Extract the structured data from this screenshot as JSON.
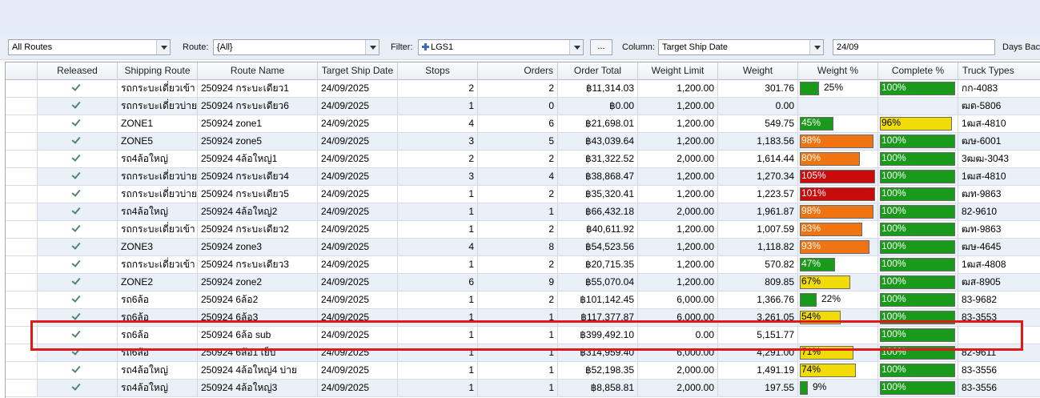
{
  "toolbar": {
    "routes_combo_value": "All Routes",
    "route_label": "Route:",
    "route_value": "{All}",
    "filter_label": "Filter:",
    "filter_value": "LGS1",
    "filter_button_label": "...",
    "column_label": "Column:",
    "column_value": "Target Ship Date",
    "date_value": "24/09",
    "days_back_label": "Days Back"
  },
  "grid": {
    "columns": [
      "Released",
      "Shipping Route",
      "Route Name",
      "Target Ship Date",
      "Stops",
      "Orders",
      "Order Total",
      "Weight Limit",
      "Weight",
      "Weight %",
      "Complete %",
      "Truck Types"
    ],
    "colors": {
      "green": "#1a9a1a",
      "yellow": "#f1dc0a",
      "orange": "#f07512",
      "red": "#c80b0b",
      "alt_row": "#eaf0f8",
      "highlight": "#e01a1a"
    },
    "rows": [
      {
        "released": true,
        "shipping_route": "รถกระบะเดี่ยวเข้า",
        "route_name": "250924 กระบะเดียว1",
        "target_ship_date": "24/09/2025",
        "stops": "2",
        "orders": "2",
        "order_total": "฿11,314.03",
        "weight_limit": "1,200.00",
        "weight": "301.76",
        "weight_pct": {
          "label": "25%",
          "value": 25,
          "color": "green"
        },
        "complete_pct": {
          "label": "100%",
          "value": 100,
          "color": "green"
        },
        "truck_types": "กก-4083"
      },
      {
        "released": true,
        "shipping_route": "รถกระบะเดี่ยวบ่าย",
        "route_name": "250924 กระบะเดียว6",
        "target_ship_date": "24/09/2025",
        "stops": "1",
        "orders": "0",
        "order_total": "฿0.00",
        "weight_limit": "1,200.00",
        "weight": "0.00",
        "weight_pct": null,
        "complete_pct": null,
        "truck_types": "ฒต-5806"
      },
      {
        "released": true,
        "shipping_route": "ZONE1",
        "route_name": "250924 zone1",
        "target_ship_date": "24/09/2025",
        "stops": "4",
        "orders": "6",
        "order_total": "฿21,698.01",
        "weight_limit": "1,200.00",
        "weight": "549.75",
        "weight_pct": {
          "label": "45%",
          "value": 45,
          "color": "green"
        },
        "complete_pct": {
          "label": "96%",
          "value": 96,
          "color": "yellow"
        },
        "truck_types": "1ฒส-4810"
      },
      {
        "released": true,
        "shipping_route": "ZONE5",
        "route_name": "250924 zone5",
        "target_ship_date": "24/09/2025",
        "stops": "3",
        "orders": "5",
        "order_total": "฿43,039.64",
        "weight_limit": "1,200.00",
        "weight": "1,183.56",
        "weight_pct": {
          "label": "98%",
          "value": 98,
          "color": "orange"
        },
        "complete_pct": {
          "label": "100%",
          "value": 100,
          "color": "green"
        },
        "truck_types": "ฒษ-6001"
      },
      {
        "released": true,
        "shipping_route": "รถ4ล้อใหญ่",
        "route_name": "250924 4ล้อใหญ่1",
        "target_ship_date": "24/09/2025",
        "stops": "2",
        "orders": "2",
        "order_total": "฿31,322.52",
        "weight_limit": "2,000.00",
        "weight": "1,614.44",
        "weight_pct": {
          "label": "80%",
          "value": 80,
          "color": "orange"
        },
        "complete_pct": {
          "label": "100%",
          "value": 100,
          "color": "green"
        },
        "truck_types": "3ฒฒ-3043"
      },
      {
        "released": true,
        "shipping_route": "รถกระบะเดี่ยวบ่าย",
        "route_name": "250924 กระบะเดียว4",
        "target_ship_date": "24/09/2025",
        "stops": "3",
        "orders": "4",
        "order_total": "฿38,868.47",
        "weight_limit": "1,200.00",
        "weight": "1,270.34",
        "weight_pct": {
          "label": "105%",
          "value": 105,
          "color": "red"
        },
        "complete_pct": {
          "label": "100%",
          "value": 100,
          "color": "green"
        },
        "truck_types": "1ฒส-4810"
      },
      {
        "released": true,
        "shipping_route": "รถกระบะเดี่ยวบ่าย",
        "route_name": "250924 กระบะเดียว5",
        "target_ship_date": "24/09/2025",
        "stops": "1",
        "orders": "2",
        "order_total": "฿35,320.41",
        "weight_limit": "1,200.00",
        "weight": "1,223.57",
        "weight_pct": {
          "label": "101%",
          "value": 101,
          "color": "red"
        },
        "complete_pct": {
          "label": "100%",
          "value": 100,
          "color": "green"
        },
        "truck_types": "ฒท-9863"
      },
      {
        "released": true,
        "shipping_route": "รถ4ล้อใหญ่",
        "route_name": "250924 4ล้อใหญ่2",
        "target_ship_date": "24/09/2025",
        "stops": "1",
        "orders": "1",
        "order_total": "฿66,432.18",
        "weight_limit": "2,000.00",
        "weight": "1,961.87",
        "weight_pct": {
          "label": "98%",
          "value": 98,
          "color": "orange"
        },
        "complete_pct": {
          "label": "100%",
          "value": 100,
          "color": "green"
        },
        "truck_types": "82-9610"
      },
      {
        "released": true,
        "shipping_route": "รถกระบะเดี่ยวเข้า",
        "route_name": "250924 กระบะเดียว2",
        "target_ship_date": "24/09/2025",
        "stops": "1",
        "orders": "2",
        "order_total": "฿40,611.92",
        "weight_limit": "1,200.00",
        "weight": "1,007.59",
        "weight_pct": {
          "label": "83%",
          "value": 83,
          "color": "orange"
        },
        "complete_pct": {
          "label": "100%",
          "value": 100,
          "color": "green"
        },
        "truck_types": "ฒท-9863"
      },
      {
        "released": true,
        "shipping_route": "ZONE3",
        "route_name": "250924 zone3",
        "target_ship_date": "24/09/2025",
        "stops": "4",
        "orders": "8",
        "order_total": "฿54,523.56",
        "weight_limit": "1,200.00",
        "weight": "1,118.82",
        "weight_pct": {
          "label": "93%",
          "value": 93,
          "color": "orange"
        },
        "complete_pct": {
          "label": "100%",
          "value": 100,
          "color": "green"
        },
        "truck_types": "ฒษ-4645"
      },
      {
        "released": true,
        "shipping_route": "รถกระบะเดี่ยวเข้า",
        "route_name": "250924 กระบะเดียว3",
        "target_ship_date": "24/09/2025",
        "stops": "1",
        "orders": "2",
        "order_total": "฿20,715.35",
        "weight_limit": "1,200.00",
        "weight": "570.82",
        "weight_pct": {
          "label": "47%",
          "value": 47,
          "color": "green"
        },
        "complete_pct": {
          "label": "100%",
          "value": 100,
          "color": "green"
        },
        "truck_types": "1ฒส-4808"
      },
      {
        "released": true,
        "shipping_route": "ZONE2",
        "route_name": "250924 zone2",
        "target_ship_date": "24/09/2025",
        "stops": "6",
        "orders": "9",
        "order_total": "฿55,070.04",
        "weight_limit": "1,200.00",
        "weight": "809.85",
        "weight_pct": {
          "label": "67%",
          "value": 67,
          "color": "yellow"
        },
        "complete_pct": {
          "label": "100%",
          "value": 100,
          "color": "green"
        },
        "truck_types": "ฒส-8905"
      },
      {
        "released": true,
        "shipping_route": "รถ6ล้อ",
        "route_name": "250924 6ล้อ2",
        "target_ship_date": "24/09/2025",
        "stops": "1",
        "orders": "2",
        "order_total": "฿101,142.45",
        "weight_limit": "6,000.00",
        "weight": "1,366.76",
        "weight_pct": {
          "label": "22%",
          "value": 22,
          "color": "green"
        },
        "complete_pct": {
          "label": "100%",
          "value": 100,
          "color": "green"
        },
        "truck_types": "83-9682"
      },
      {
        "released": true,
        "shipping_route": "รถ6ล้อ",
        "route_name": "250924 6ล้อ3",
        "target_ship_date": "24/09/2025",
        "stops": "1",
        "orders": "1",
        "order_total": "฿117,377.87",
        "weight_limit": "6,000.00",
        "weight": "3,261.05",
        "weight_pct": {
          "label": "54%",
          "value": 54,
          "color": "yellow"
        },
        "complete_pct": {
          "label": "100%",
          "value": 100,
          "color": "green"
        },
        "truck_types": "83-3553"
      },
      {
        "released": true,
        "shipping_route": "รถ6ล้อ",
        "route_name": "250924 6ล้อ sub",
        "target_ship_date": "24/09/2025",
        "stops": "1",
        "orders": "1",
        "order_total": "฿399,492.10",
        "weight_limit": "0.00",
        "weight": "5,151.77",
        "weight_pct": null,
        "complete_pct": {
          "label": "100%",
          "value": 100,
          "color": "green"
        },
        "truck_types": ""
      },
      {
        "released": true,
        "shipping_route": "รถ6ล้อ",
        "route_name": "250924 6ล้อ1 เย็บ",
        "target_ship_date": "24/09/2025",
        "stops": "1",
        "orders": "1",
        "order_total": "฿314,959.40",
        "weight_limit": "6,000.00",
        "weight": "4,291.00",
        "weight_pct": {
          "label": "71%",
          "value": 71,
          "color": "yellow"
        },
        "complete_pct": {
          "label": "100%",
          "value": 100,
          "color": "green"
        },
        "truck_types": "82-9611"
      },
      {
        "released": true,
        "shipping_route": "รถ4ล้อใหญ่",
        "route_name": "250924 4ล้อใหญ่4 บ่าย",
        "target_ship_date": "24/09/2025",
        "stops": "1",
        "orders": "1",
        "order_total": "฿52,198.35",
        "weight_limit": "2,000.00",
        "weight": "1,491.19",
        "weight_pct": {
          "label": "74%",
          "value": 74,
          "color": "yellow"
        },
        "complete_pct": {
          "label": "100%",
          "value": 100,
          "color": "green"
        },
        "truck_types": "83-3556"
      },
      {
        "released": true,
        "shipping_route": "รถ4ล้อใหญ่",
        "route_name": "250924 4ล้อใหญ่3",
        "target_ship_date": "24/09/2025",
        "stops": "1",
        "orders": "1",
        "order_total": "฿8,858.81",
        "weight_limit": "2,000.00",
        "weight": "197.55",
        "weight_pct": {
          "label": "9%",
          "value": 9,
          "color": "green"
        },
        "complete_pct": {
          "label": "100%",
          "value": 100,
          "color": "green"
        },
        "truck_types": "83-3556"
      }
    ]
  }
}
